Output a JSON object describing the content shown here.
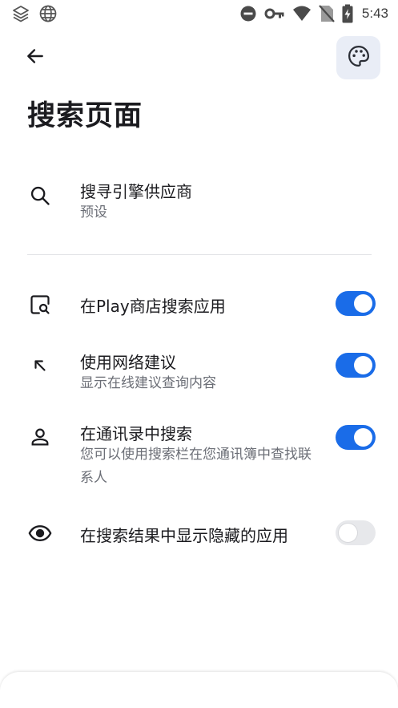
{
  "status_bar": {
    "time": "5:43",
    "left_icons": [
      "layers-icon",
      "globe-icon"
    ],
    "right_icons": [
      "do-not-disturb-icon",
      "vpn-key-icon",
      "wifi-icon",
      "no-sim-icon",
      "battery-charging-icon"
    ]
  },
  "header": {
    "title": "搜索页面",
    "back_icon": "arrow-left-icon",
    "theme_icon": "palette-icon"
  },
  "search_engine": {
    "title": "搜寻引擎供应商",
    "subtitle": "预设",
    "icon": "search-icon"
  },
  "settings": [
    {
      "title": "在Play商店搜索应用",
      "subtitle": "",
      "icon": "store-search-icon",
      "enabled": true
    },
    {
      "title": "使用网络建议",
      "subtitle": "显示在线建议查询内容",
      "icon": "arrow-up-left-icon",
      "enabled": true
    },
    {
      "title": "在通讯录中搜索",
      "subtitle": "您可以使用搜索栏在您通讯簿中查找联系人",
      "icon": "person-icon",
      "enabled": true
    },
    {
      "title": "在搜索结果中显示隐藏的应用",
      "subtitle": "",
      "icon": "eye-icon",
      "enabled": false
    }
  ],
  "colors": {
    "accent": "#1a6ce8",
    "toggle_off": "#e7e8eb",
    "theme_button_bg": "#e9edf6"
  }
}
